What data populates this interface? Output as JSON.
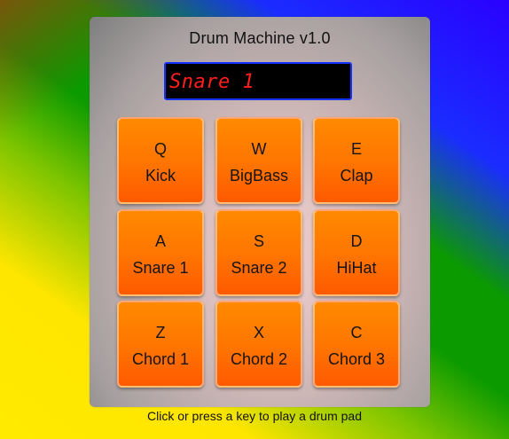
{
  "app": {
    "title": "Drum Machine v1.0"
  },
  "display": {
    "text": "Snare 1"
  },
  "pads": [
    {
      "key": "Q",
      "name": "Kick"
    },
    {
      "key": "W",
      "name": "BigBass"
    },
    {
      "key": "E",
      "name": "Clap"
    },
    {
      "key": "A",
      "name": "Snare 1"
    },
    {
      "key": "S",
      "name": "Snare 2"
    },
    {
      "key": "D",
      "name": "HiHat"
    },
    {
      "key": "Z",
      "name": "Chord 1"
    },
    {
      "key": "X",
      "name": "Chord 2"
    },
    {
      "key": "C",
      "name": "Chord 3"
    }
  ],
  "footer": {
    "hint": "Click or press a key to play a drum pad"
  },
  "colors": {
    "pad_orange": "#ff7a00",
    "display_text_red": "#ff1e1e",
    "display_border_blue": "#1630ff"
  }
}
